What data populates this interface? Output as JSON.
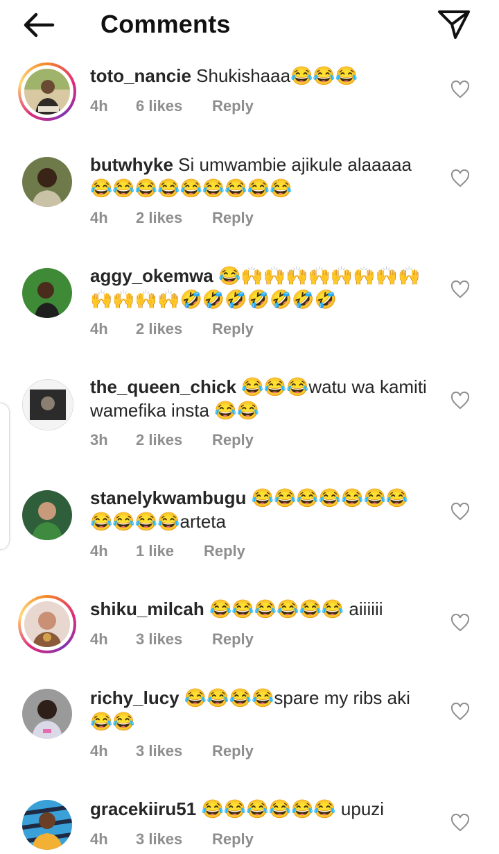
{
  "header": {
    "title": "Comments"
  },
  "icons": {
    "back": "arrow-left-icon",
    "send": "paper-plane-icon",
    "like": "heart-outline-icon"
  },
  "colors": {
    "accent_ring_start": "#f58529",
    "accent_ring_end": "#dd2a7b",
    "meta_text": "#8e8e8e"
  },
  "comments": [
    {
      "username": "toto_nancie",
      "text": "Shukishaaa😂😂😂",
      "time": "4h",
      "likes": "6 likes",
      "reply": "Reply",
      "story_ring": true
    },
    {
      "username": "butwhyke",
      "text": "Si umwambie ajikule alaaaaa 😂😂😂😂😂😂😂😂😂",
      "time": "4h",
      "likes": "2 likes",
      "reply": "Reply",
      "story_ring": false
    },
    {
      "username": "aggy_okemwa",
      "text": "😂🙌🙌🙌🙌🙌🙌🙌🙌🙌🙌🙌🙌🤣🤣🤣🤣🤣🤣🤣",
      "time": "4h",
      "likes": "2 likes",
      "reply": "Reply",
      "story_ring": false
    },
    {
      "username": "the_queen_chick",
      "text": "😂😂😂watu wa kamiti wamefika insta 😂😂",
      "time": "3h",
      "likes": "2 likes",
      "reply": "Reply",
      "story_ring": false
    },
    {
      "username": "stanelykwambugu",
      "text": "😂😂😂😂😂😂😂😂😂😂😂arteta",
      "time": "4h",
      "likes": "1 like",
      "reply": "Reply",
      "story_ring": false
    },
    {
      "username": "shiku_milcah",
      "text": "😂😂😂😂😂😂 aiiiiii",
      "time": "4h",
      "likes": "3 likes",
      "reply": "Reply",
      "story_ring": true
    },
    {
      "username": "richy_lucy",
      "text": "😂😂😂😂spare my ribs aki 😂😂",
      "time": "4h",
      "likes": "3 likes",
      "reply": "Reply",
      "story_ring": false
    },
    {
      "username": "gracekiiru51",
      "text": "😂😂😂😂😂😂 upuzi",
      "time": "4h",
      "likes": "3 likes",
      "reply": "Reply",
      "story_ring": false
    }
  ]
}
